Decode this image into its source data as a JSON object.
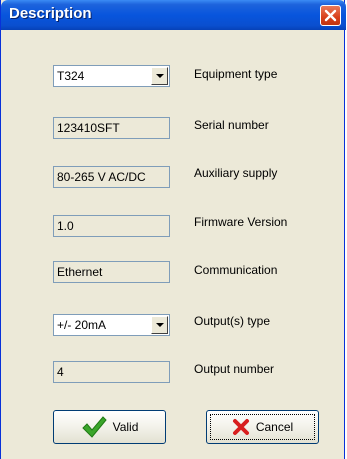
{
  "window": {
    "title": "Description"
  },
  "fields": {
    "equipment_type": {
      "value": "T324",
      "label": "Equipment type"
    },
    "serial_number": {
      "value": "123410SFT",
      "label": "Serial number"
    },
    "auxiliary_supply": {
      "value": "80-265 V AC/DC",
      "label": "Auxiliary supply"
    },
    "firmware_version": {
      "value": "1.0",
      "label": "Firmware Version"
    },
    "communication": {
      "value": "Ethernet",
      "label": "Communication"
    },
    "output_type": {
      "value": "+/- 20mA",
      "label": "Output(s) type"
    },
    "output_number": {
      "value": "4",
      "label": "Output number"
    }
  },
  "buttons": {
    "valid": "Valid",
    "cancel": "Cancel"
  },
  "icons": {
    "close": "close-icon",
    "valid": "checkmark-icon",
    "cancel": "red-x-icon",
    "dropdown": "chevron-down-icon"
  },
  "colors": {
    "titlebar": "#0855dd",
    "close_button": "#d8401b",
    "check": "#3aa52a",
    "cancel_x": "#d81e1e",
    "dialog_bg": "#ece9d8"
  }
}
